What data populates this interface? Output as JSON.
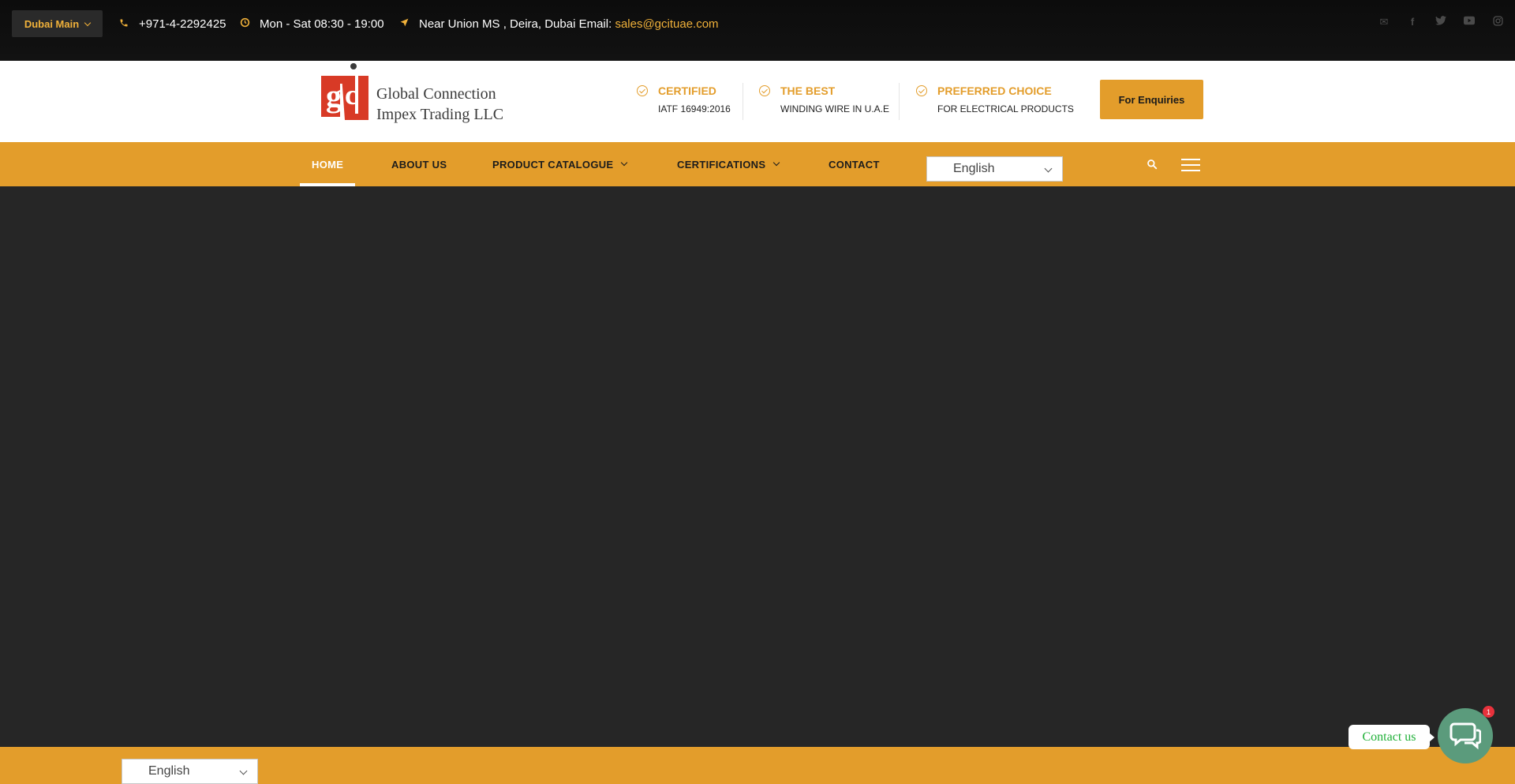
{
  "topbar": {
    "branch_label": "Dubai Main",
    "phone": "+971-4-2292425",
    "hours": "Mon - Sat 08:30 - 19:00",
    "address": "Near Union MS , Deira, Dubai Email:",
    "email": "sales@gcituae.com",
    "socials": [
      "envelope-icon",
      "facebook-icon",
      "twitter-icon",
      "youtube-icon",
      "instagram-icon"
    ]
  },
  "header": {
    "logo_line1": "Global Connection",
    "logo_line2": "Impex Trading LLC",
    "features": [
      {
        "title": "CERTIFIED",
        "subtitle": "IATF 16949:2016"
      },
      {
        "title": "THE BEST",
        "subtitle": "WINDING WIRE IN U.A.E"
      },
      {
        "title": "PREFERRED CHOICE",
        "subtitle": "FOR ELECTRICAL PRODUCTS"
      }
    ],
    "enquiry_label": "For Enquiries"
  },
  "nav": {
    "items": [
      {
        "label": "HOME",
        "active": true
      },
      {
        "label": "ABOUT US"
      },
      {
        "label": "PRODUCT CATALOGUE",
        "has_dropdown": true
      },
      {
        "label": "CERTIFICATIONS",
        "has_dropdown": true
      },
      {
        "label": "CONTACT"
      }
    ],
    "language": "English"
  },
  "footer": {
    "language": "English"
  },
  "contact_widget": {
    "label": "Contact us",
    "badge_count": "1"
  },
  "colors": {
    "accent": "#e39d2b",
    "topbar_bg": "#0f0f0f",
    "hero_bg": "#262626",
    "contact_green": "#20b038"
  }
}
